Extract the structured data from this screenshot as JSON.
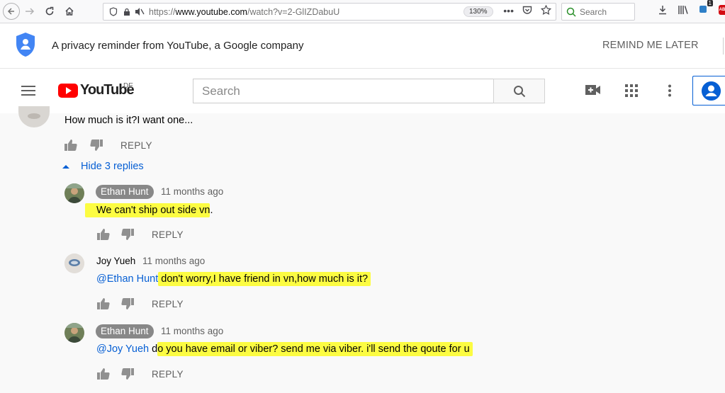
{
  "browser": {
    "url_scheme": "https://",
    "url_host": "www.youtube.com",
    "url_path": "/watch?v=2-GlIZDabuU",
    "zoom": "130%",
    "search_placeholder": "Search",
    "extension_badge": "1",
    "abp_label": "ABP"
  },
  "privacy": {
    "message": "A privacy reminder from YouTube, a Google company",
    "remind_label": "REMIND ME LATER"
  },
  "masthead": {
    "logo_text": "YouTube",
    "region": "DE",
    "search_placeholder": "Search"
  },
  "comments": {
    "top": {
      "text": "How much is it?I want one...",
      "reply_label": "REPLY"
    },
    "hide_replies_label": "Hide 3 replies",
    "replies": [
      {
        "author": "Ethan Hunt",
        "time": "11 months ago",
        "mention": "",
        "text_highlight": "We can't ship out side vn",
        "text_rest": ".",
        "reply_label": "REPLY"
      },
      {
        "author": "Joy Yueh",
        "time": "11 months ago",
        "mention": "@Ethan Hunt",
        "text_highlight": "don't worry,I have friend in vn,how much is it?",
        "text_rest": "",
        "reply_label": "REPLY"
      },
      {
        "author": "Ethan Hunt",
        "time": "11 months ago",
        "mention": "@Joy Yueh",
        "text_pre": " d",
        "text_highlight": "o you have email or viber? send me via viber. i'll send the qoute for u",
        "text_rest": "",
        "reply_label": "REPLY"
      }
    ]
  },
  "colors": {
    "accent_blue": "#065fd4",
    "highlight": "#fcfc42",
    "youtube_red": "#ff0000"
  }
}
